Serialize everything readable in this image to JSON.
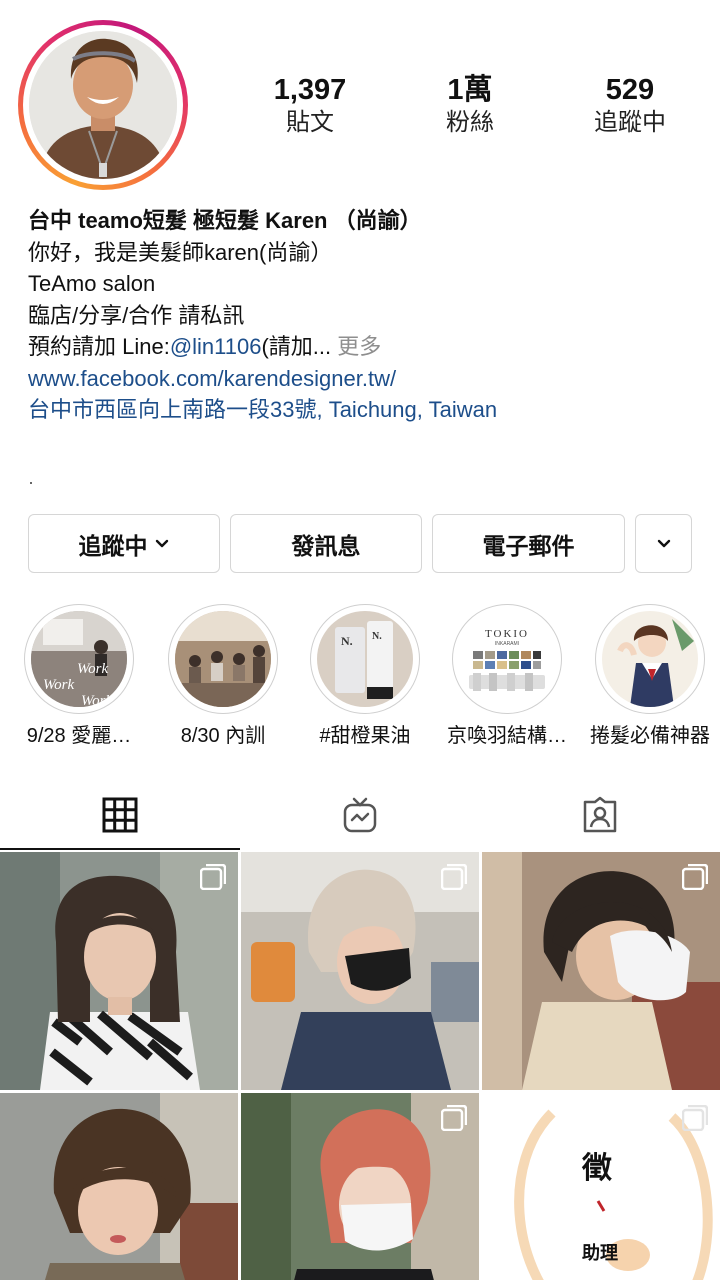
{
  "profile": {
    "stats": [
      {
        "value": "1,397",
        "label": "貼文"
      },
      {
        "value": "1萬",
        "label": "粉絲"
      },
      {
        "value": "529",
        "label": "追蹤中"
      }
    ],
    "name": "台中 teamo短髮 極短髮 Karen （尚諭）",
    "bio_line1": "你好，我是美髮師karen(尚諭）",
    "bio_line2": "TeAmo salon",
    "bio_line3": "臨店/分享/合作 請私訊",
    "bio_line4_prefix": "預約請加 Line:",
    "bio_line4_handle": "@lin1106",
    "bio_line4_suffix": "(請加... ",
    "bio_more": "更多",
    "website": "www.facebook.com/karendesigner.tw/",
    "address": "台中市西區向上南路一段33號, Taichung, Taiwan"
  },
  "actions": {
    "following": "追蹤中",
    "message": "發訊息",
    "email": "電子郵件"
  },
  "highlights": [
    {
      "label": "9/28 愛麗…",
      "overlay": "Work"
    },
    {
      "label": "8/30 內訓"
    },
    {
      "label": "#甜橙果油",
      "brand": "N."
    },
    {
      "label": "京喚羽結構…",
      "brand": "TOKIO",
      "brand_sub": "INKARAMI"
    },
    {
      "label": "捲髮必備神器"
    }
  ],
  "grid": {
    "tile6_text1": "徵",
    "tile6_text2": "助理"
  },
  "icons": {
    "grid_tab": "grid-icon",
    "tv_tab": "igtv-icon",
    "tagged_tab": "tagged-icon",
    "multi": "carousel-icon"
  },
  "colors": {
    "link": "#1d4e8a",
    "ring_start": "#f9a034",
    "ring_end": "#c2177a"
  }
}
